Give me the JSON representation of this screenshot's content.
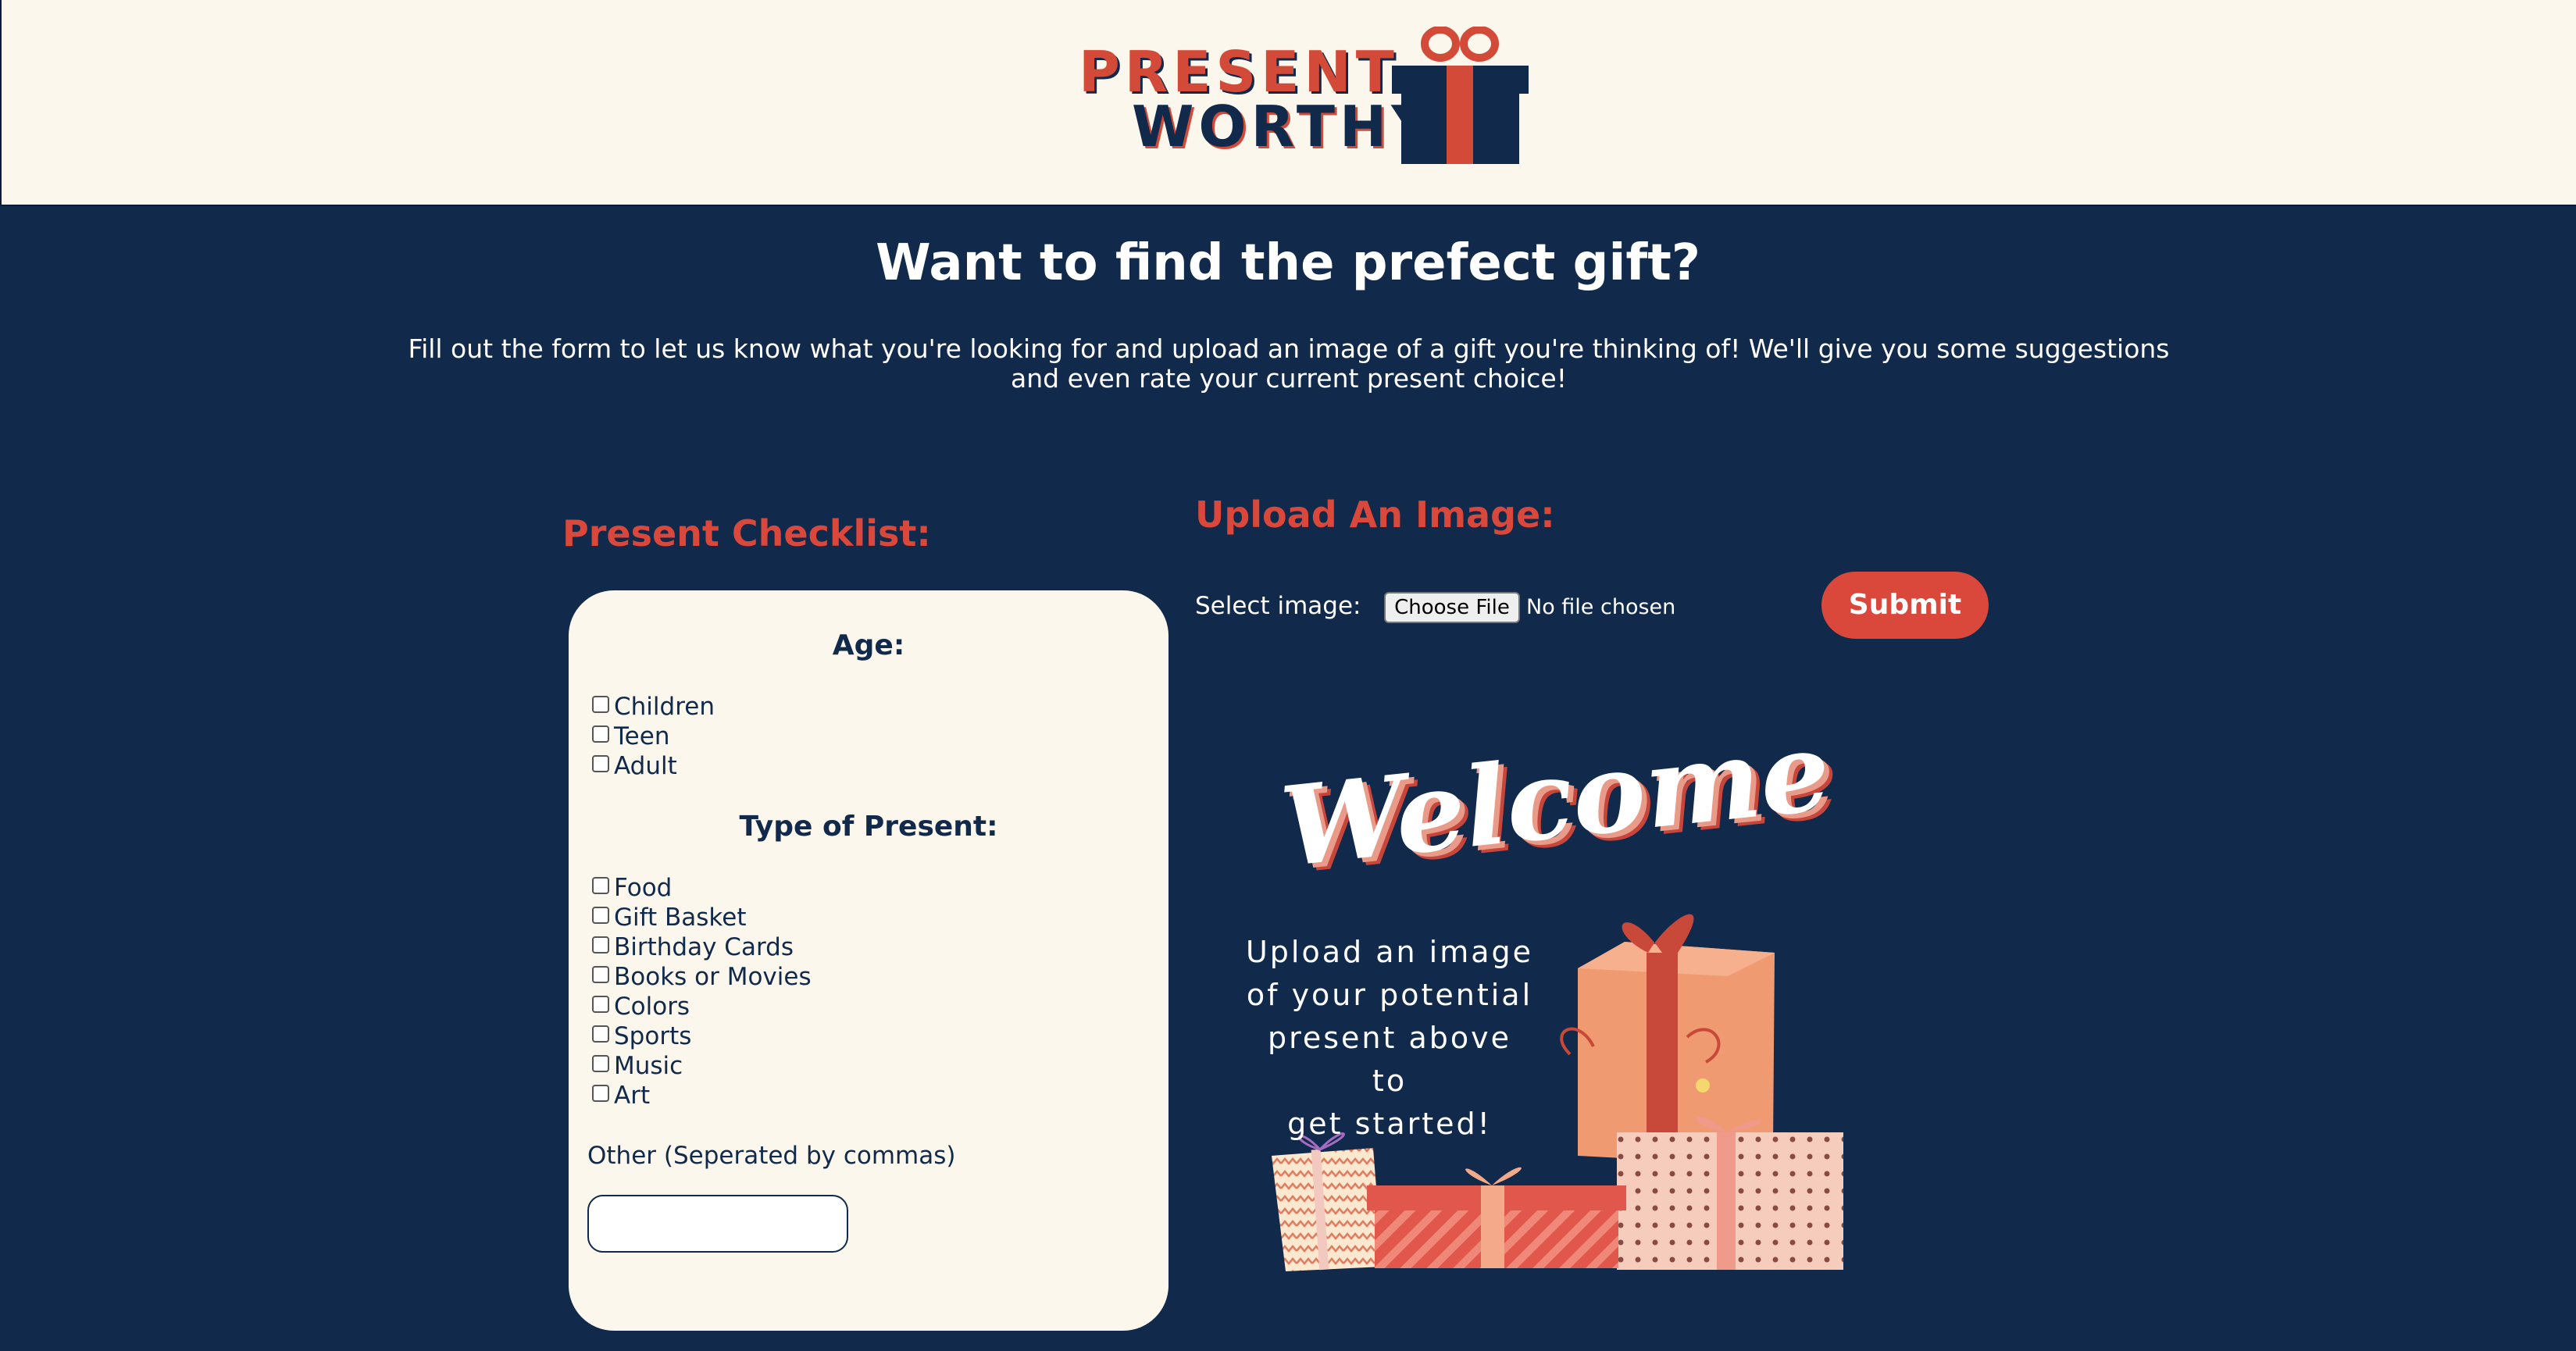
{
  "header": {
    "logo_line1": "PRESENT",
    "logo_line2": "WORTHY"
  },
  "hero": {
    "title": "Want to find the prefect gift?",
    "subtitle": "Fill out the form to let us know what you're looking for and upload an image of a gift you're thinking of! We'll give you some suggestions and even rate your current present choice!"
  },
  "checklist": {
    "title": "Present Checklist:",
    "age_heading": "Age:",
    "age_options": [
      "Children",
      "Teen",
      "Adult"
    ],
    "type_heading": "Type of Present:",
    "type_options": [
      "Food",
      "Gift Basket",
      "Birthday Cards",
      "Books or Movies",
      "Colors",
      "Sports",
      "Music",
      "Art"
    ],
    "other_label": "Other (Seperated by commas)",
    "other_value": ""
  },
  "upload": {
    "title": "Upload An Image:",
    "select_label": "Select image:",
    "choose_file_label": "Choose File",
    "no_file_text": "No file chosen",
    "submit_label": "Submit"
  },
  "welcome": {
    "heading": "Welcome",
    "line1": "Upload an image",
    "line2": "of your potential",
    "line3": "present above to",
    "line4": "get started!"
  },
  "colors": {
    "navy": "#11294a",
    "cream": "#fbf7ed",
    "accent_red": "#d9483a"
  },
  "icons": {
    "logo_gift": "gift-box-icon"
  }
}
